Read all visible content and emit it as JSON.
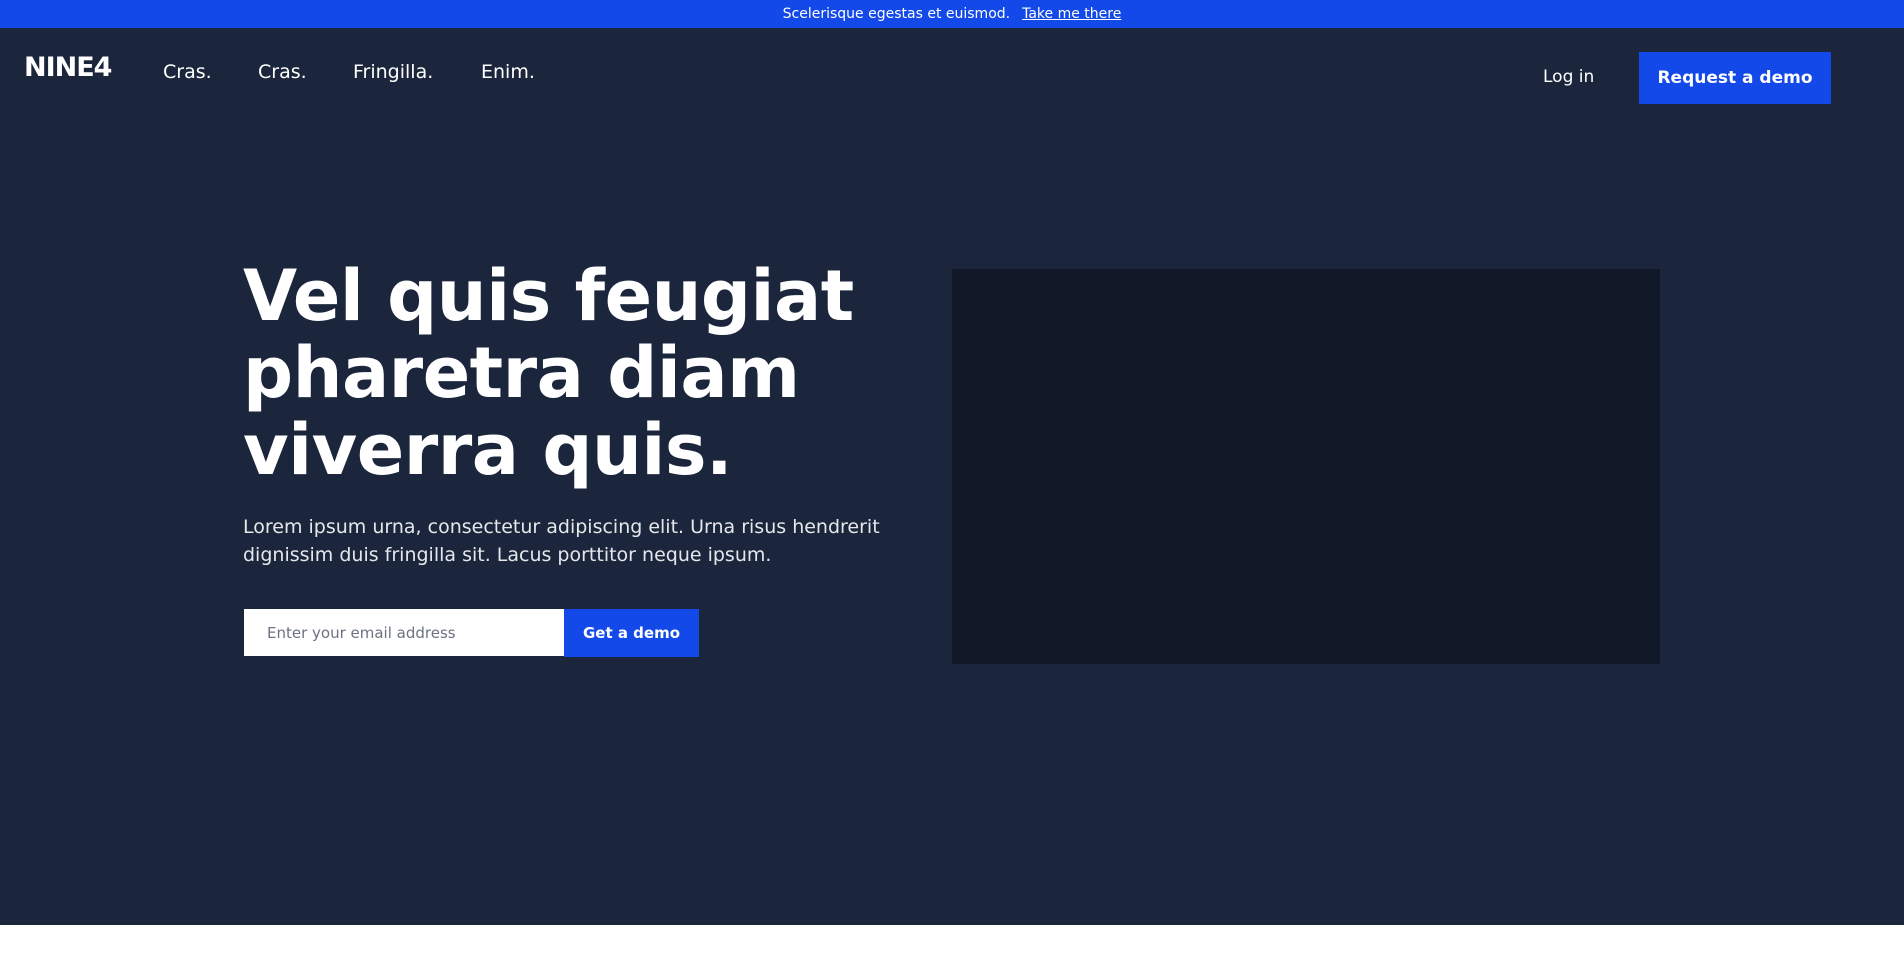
{
  "announcement": {
    "text": "Scelerisque egestas et euismod.",
    "link": "Take me there"
  },
  "header": {
    "logo": "NINE4",
    "nav": [
      "Cras.",
      "Cras.",
      "Fringilla.",
      "Enim."
    ],
    "login": "Log in",
    "cta": "Request a demo"
  },
  "hero": {
    "headline_lines": [
      "Vel quis feugiat",
      "pharetra diam",
      "viverra quis."
    ],
    "subtext_lines": [
      "Lorem ipsum urna, consectetur adipiscing elit. Urna risus hendrerit",
      "dignissim duis fringilla sit. Lacus porttitor neque ipsum."
    ],
    "email_placeholder": "Enter your email address",
    "submit": "Get a demo"
  },
  "colors": {
    "accent": "#1349e8",
    "hero_bg": "#1b263c",
    "media_bg": "#111827"
  }
}
